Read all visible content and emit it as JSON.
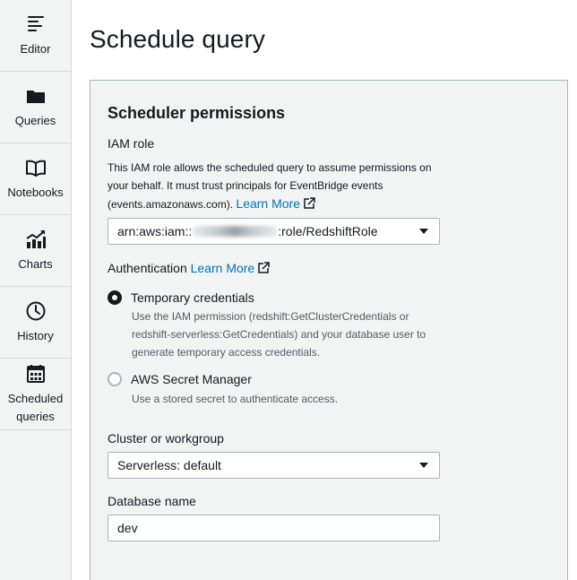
{
  "sidebar": {
    "items": [
      {
        "label": "Editor",
        "icon": "editor-icon"
      },
      {
        "label": "Queries",
        "icon": "folder-icon"
      },
      {
        "label": "Notebooks",
        "icon": "book-icon"
      },
      {
        "label": "Charts",
        "icon": "chart-icon"
      },
      {
        "label": "History",
        "icon": "clock-icon"
      },
      {
        "label": "Scheduled queries",
        "icon": "calendar-icon"
      }
    ]
  },
  "page": {
    "title": "Schedule query"
  },
  "permissions": {
    "title": "Scheduler permissions",
    "iam_role": {
      "label": "IAM role",
      "description": "This IAM role allows the scheduled query to assume permissions on your behalf. It must trust principals for EventBridge events (events.amazonaws.com).",
      "learn_more": "Learn More",
      "value_prefix": "arn:aws:iam::",
      "value_suffix": ":role/RedshiftRole"
    },
    "authentication": {
      "label": "Authentication",
      "learn_more": "Learn More",
      "options": [
        {
          "label": "Temporary credentials",
          "description": "Use the IAM permission (redshift:GetClusterCredentials or redshift-serverless:GetCredentials) and your database user to generate temporary access credentials.",
          "selected": true
        },
        {
          "label": "AWS Secret Manager",
          "description": "Use a stored secret to authenticate access.",
          "selected": false
        }
      ]
    },
    "cluster": {
      "label": "Cluster or workgroup",
      "value": "Serverless: default"
    },
    "database": {
      "label": "Database name",
      "value": "dev"
    }
  },
  "colors": {
    "link": "#0073bb",
    "panel_bg": "#f2f3f3",
    "text": "#16191f"
  }
}
